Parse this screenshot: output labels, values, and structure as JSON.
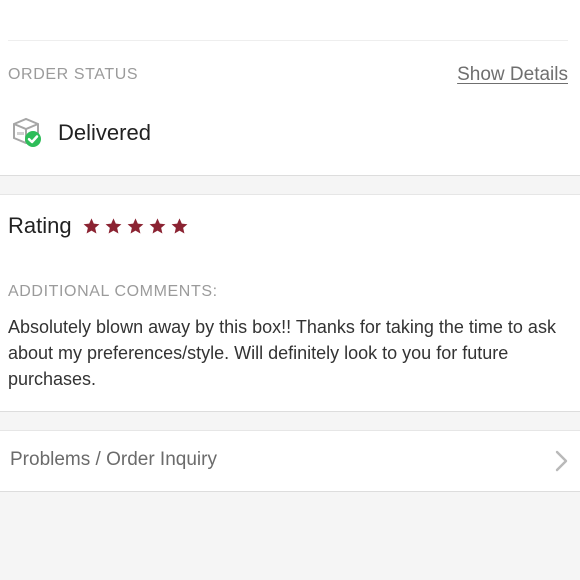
{
  "order_status": {
    "label": "ORDER STATUS",
    "details_link": "Show Details",
    "status_text": "Delivered",
    "status_icon": "delivered-box-check-icon",
    "check_color": "#2ebd59"
  },
  "rating": {
    "label": "Rating",
    "stars": 5,
    "max_stars": 5,
    "star_color": "#8b2332"
  },
  "comments": {
    "label": "ADDITIONAL COMMENTS:",
    "text": "Absolutely blown away by this box!! Thanks for taking the time to ask about my preferences/style. Will definitely look to you for future purchases."
  },
  "inquiry": {
    "label": "Problems / Order Inquiry",
    "icon": "chevron-right-icon"
  }
}
